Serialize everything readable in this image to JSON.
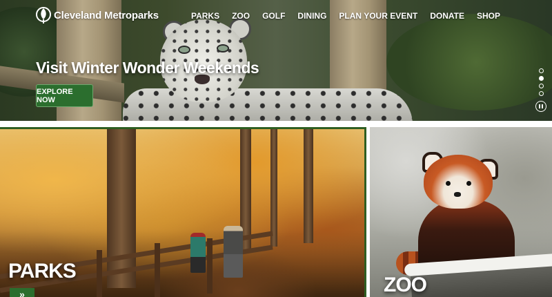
{
  "brand": {
    "name": "Cleveland Metroparks"
  },
  "nav": {
    "items": [
      "PARKS",
      "ZOO",
      "GOLF",
      "DINING",
      "PLAN YOUR EVENT",
      "DONATE",
      "SHOP"
    ]
  },
  "hero": {
    "title": "Visit Winter Wonder Weekends",
    "cta": "EXPLORE NOW",
    "slides_total": 4,
    "active_slide": 2
  },
  "cards": [
    {
      "label": "PARKS",
      "arrow": "»"
    },
    {
      "label": "ZOO"
    }
  ],
  "colors": {
    "accent_green": "#2b6e2e",
    "border_green": "#2e5e22"
  }
}
